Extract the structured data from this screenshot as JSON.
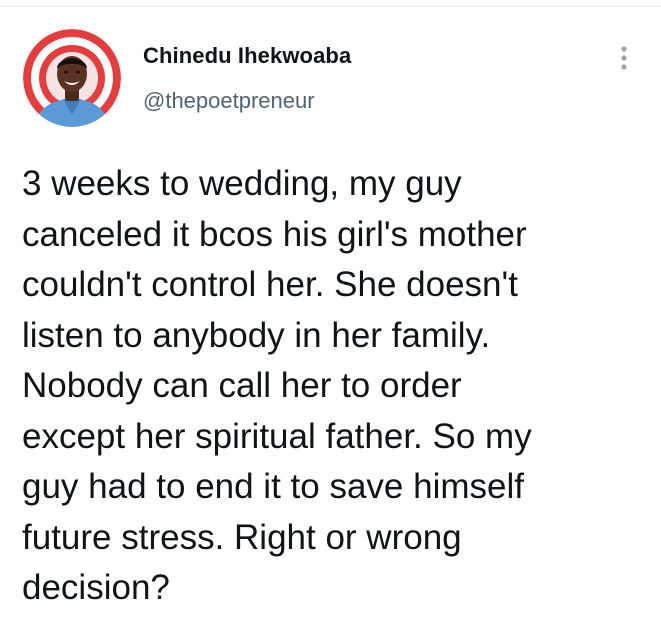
{
  "tweet": {
    "author_name": "Chinedu Ihekwoaba",
    "author_handle": "@thepoetpreneur",
    "text": "3 weeks to wedding, my guy\ncanceled it bcos his girl's mother\ncouldn't control her. She doesn't\nlisten to anybody in her family.\nNobody can call her to order\nexcept her spiritual father. So my\nguy had to end it to save himself\nfuture stress. Right or wrong\ndecision?"
  },
  "icons": {
    "more": "more-vertical-icon",
    "avatar": "avatar"
  },
  "colors": {
    "avatar_ring": "#e43d3d",
    "text_primary": "#0f1419",
    "text_secondary": "#536471",
    "icon_gray": "#9aa4ab"
  }
}
